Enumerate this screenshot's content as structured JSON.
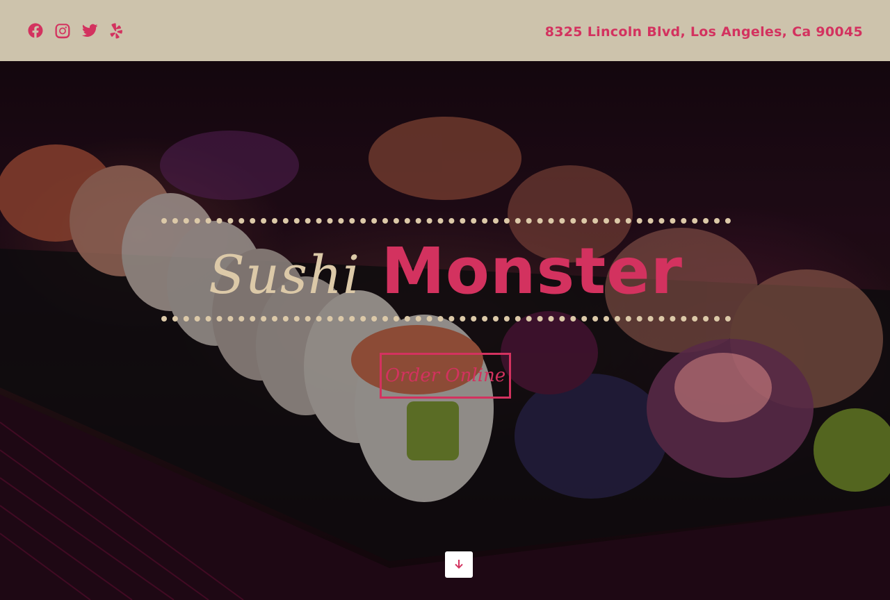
{
  "header": {
    "social": [
      {
        "name": "facebook-icon"
      },
      {
        "name": "instagram-icon"
      },
      {
        "name": "twitter-icon"
      },
      {
        "name": "yelp-icon"
      }
    ],
    "address": "8325 Lincoln Blvd, Los Angeles, Ca 90045"
  },
  "hero": {
    "title_script": "Sushi",
    "title_bold": "Monster",
    "order_button": "Order Online",
    "scroll_icon": "arrow-down-icon"
  },
  "colors": {
    "accent": "#d3325f",
    "topbar": "#cdc3ac",
    "cream": "#dcc9a8"
  }
}
